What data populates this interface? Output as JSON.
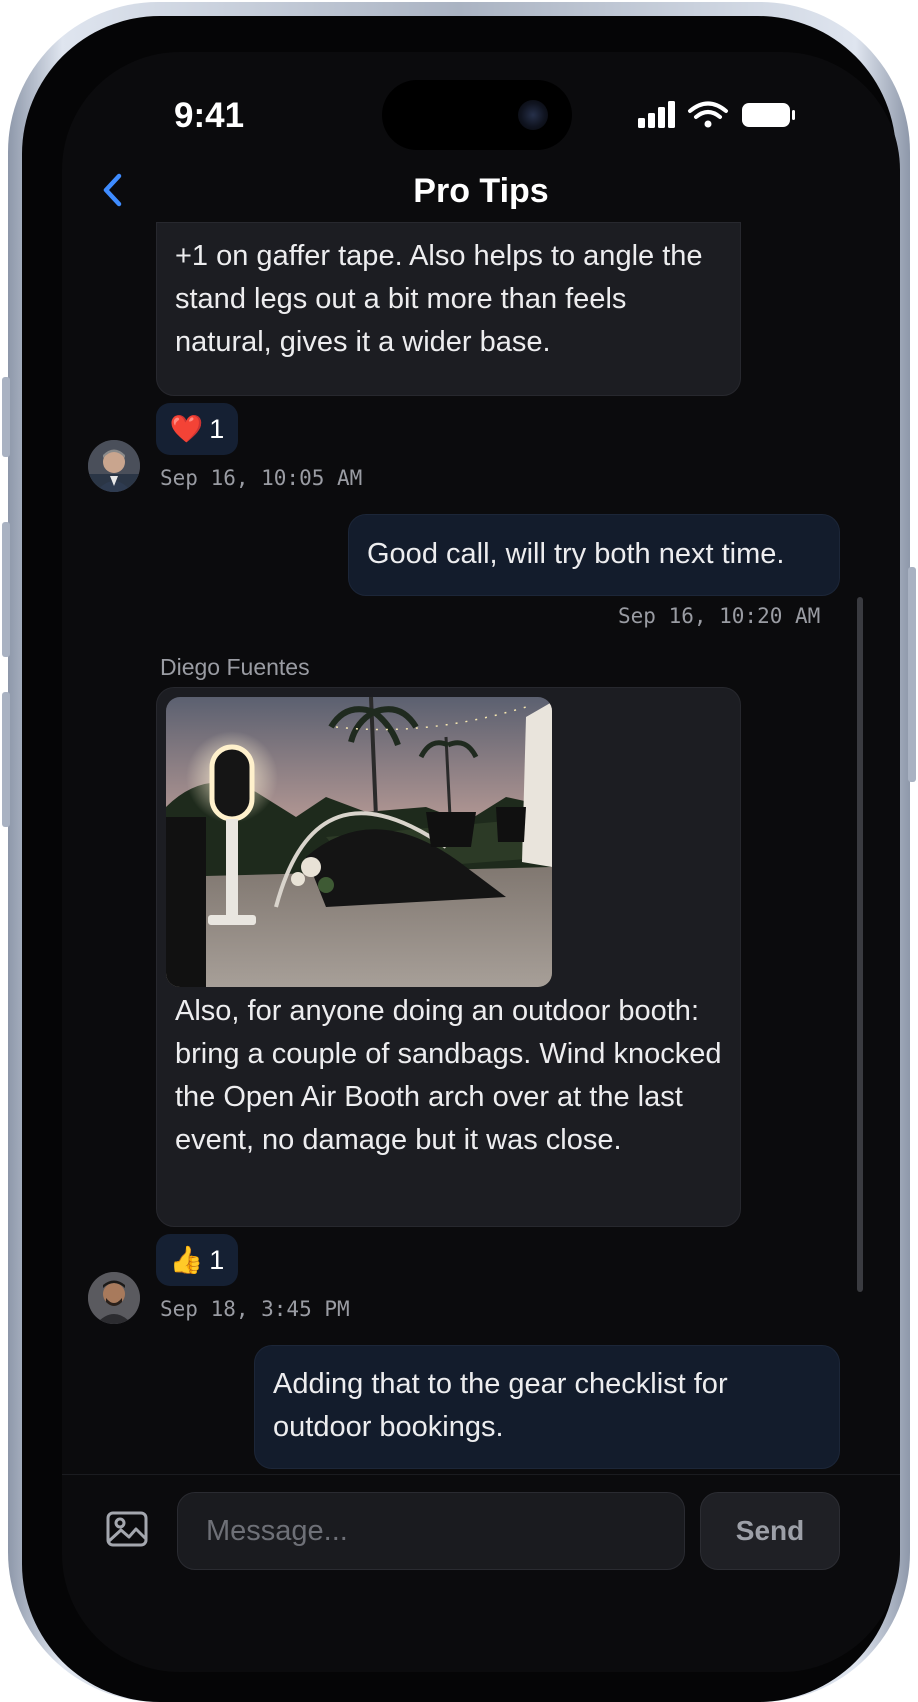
{
  "status_bar": {
    "time": "9:41"
  },
  "header": {
    "title": "Pro Tips"
  },
  "messages": [
    {
      "text": "+1 on gaffer tape. Also helps to angle the stand legs out a bit more than feels natural, gives it a wider base.",
      "reaction": {
        "emoji": "❤️",
        "count": "1"
      },
      "timestamp": "Sep 16, 10:05 AM"
    },
    {
      "text": "Good call, will try both next time.",
      "timestamp": "Sep 16, 10:20 AM"
    },
    {
      "sender": "Diego Fuentes",
      "text": "Also, for anyone doing an outdoor booth: bring a couple of sandbags. Wind knocked the Open Air Booth arch over at the last event, no damage but it was close.",
      "reaction": {
        "emoji": "👍",
        "count": "1"
      },
      "timestamp": "Sep 18, 3:45 PM"
    },
    {
      "text": "Adding that to the gear checklist for outdoor bookings."
    }
  ],
  "composer": {
    "placeholder": "Message...",
    "send_label": "Send"
  },
  "icons": {
    "back": "chevron-left-icon",
    "attach": "image-icon",
    "signal": "signal-icon",
    "wifi": "wifi-icon",
    "battery": "battery-icon"
  },
  "colors": {
    "accent": "#3f8cff",
    "background": "#0b0b0d",
    "bubble": "#1c1d22",
    "own_bubble": "#131c2c"
  }
}
